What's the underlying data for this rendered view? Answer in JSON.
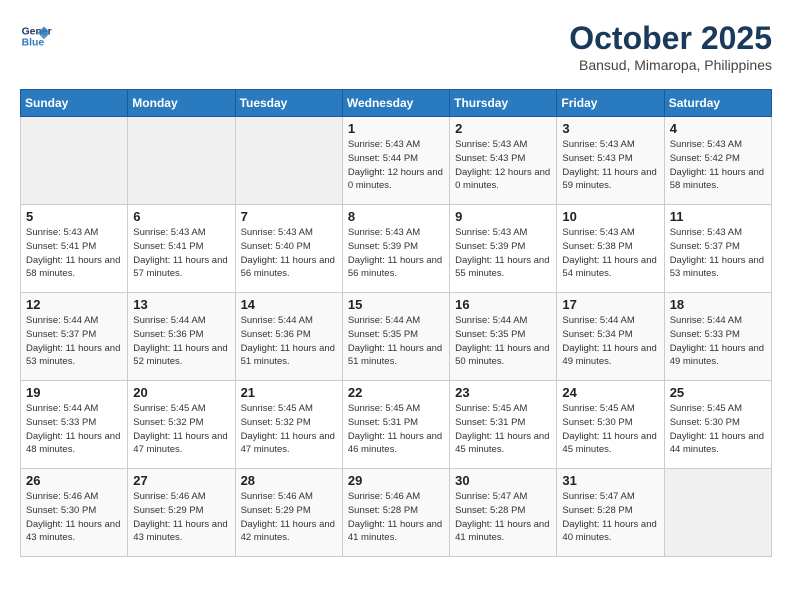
{
  "header": {
    "logo_line1": "General",
    "logo_line2": "Blue",
    "month": "October 2025",
    "location": "Bansud, Mimaropa, Philippines"
  },
  "weekdays": [
    "Sunday",
    "Monday",
    "Tuesday",
    "Wednesday",
    "Thursday",
    "Friday",
    "Saturday"
  ],
  "weeks": [
    [
      {
        "day": "",
        "empty": true
      },
      {
        "day": "",
        "empty": true
      },
      {
        "day": "",
        "empty": true
      },
      {
        "day": "1",
        "sunrise": "5:43 AM",
        "sunset": "5:44 PM",
        "daylight": "12 hours and 0 minutes."
      },
      {
        "day": "2",
        "sunrise": "5:43 AM",
        "sunset": "5:43 PM",
        "daylight": "12 hours and 0 minutes."
      },
      {
        "day": "3",
        "sunrise": "5:43 AM",
        "sunset": "5:43 PM",
        "daylight": "11 hours and 59 minutes."
      },
      {
        "day": "4",
        "sunrise": "5:43 AM",
        "sunset": "5:42 PM",
        "daylight": "11 hours and 58 minutes."
      }
    ],
    [
      {
        "day": "5",
        "sunrise": "5:43 AM",
        "sunset": "5:41 PM",
        "daylight": "11 hours and 58 minutes."
      },
      {
        "day": "6",
        "sunrise": "5:43 AM",
        "sunset": "5:41 PM",
        "daylight": "11 hours and 57 minutes."
      },
      {
        "day": "7",
        "sunrise": "5:43 AM",
        "sunset": "5:40 PM",
        "daylight": "11 hours and 56 minutes."
      },
      {
        "day": "8",
        "sunrise": "5:43 AM",
        "sunset": "5:39 PM",
        "daylight": "11 hours and 56 minutes."
      },
      {
        "day": "9",
        "sunrise": "5:43 AM",
        "sunset": "5:39 PM",
        "daylight": "11 hours and 55 minutes."
      },
      {
        "day": "10",
        "sunrise": "5:43 AM",
        "sunset": "5:38 PM",
        "daylight": "11 hours and 54 minutes."
      },
      {
        "day": "11",
        "sunrise": "5:43 AM",
        "sunset": "5:37 PM",
        "daylight": "11 hours and 53 minutes."
      }
    ],
    [
      {
        "day": "12",
        "sunrise": "5:44 AM",
        "sunset": "5:37 PM",
        "daylight": "11 hours and 53 minutes."
      },
      {
        "day": "13",
        "sunrise": "5:44 AM",
        "sunset": "5:36 PM",
        "daylight": "11 hours and 52 minutes."
      },
      {
        "day": "14",
        "sunrise": "5:44 AM",
        "sunset": "5:36 PM",
        "daylight": "11 hours and 51 minutes."
      },
      {
        "day": "15",
        "sunrise": "5:44 AM",
        "sunset": "5:35 PM",
        "daylight": "11 hours and 51 minutes."
      },
      {
        "day": "16",
        "sunrise": "5:44 AM",
        "sunset": "5:35 PM",
        "daylight": "11 hours and 50 minutes."
      },
      {
        "day": "17",
        "sunrise": "5:44 AM",
        "sunset": "5:34 PM",
        "daylight": "11 hours and 49 minutes."
      },
      {
        "day": "18",
        "sunrise": "5:44 AM",
        "sunset": "5:33 PM",
        "daylight": "11 hours and 49 minutes."
      }
    ],
    [
      {
        "day": "19",
        "sunrise": "5:44 AM",
        "sunset": "5:33 PM",
        "daylight": "11 hours and 48 minutes."
      },
      {
        "day": "20",
        "sunrise": "5:45 AM",
        "sunset": "5:32 PM",
        "daylight": "11 hours and 47 minutes."
      },
      {
        "day": "21",
        "sunrise": "5:45 AM",
        "sunset": "5:32 PM",
        "daylight": "11 hours and 47 minutes."
      },
      {
        "day": "22",
        "sunrise": "5:45 AM",
        "sunset": "5:31 PM",
        "daylight": "11 hours and 46 minutes."
      },
      {
        "day": "23",
        "sunrise": "5:45 AM",
        "sunset": "5:31 PM",
        "daylight": "11 hours and 45 minutes."
      },
      {
        "day": "24",
        "sunrise": "5:45 AM",
        "sunset": "5:30 PM",
        "daylight": "11 hours and 45 minutes."
      },
      {
        "day": "25",
        "sunrise": "5:45 AM",
        "sunset": "5:30 PM",
        "daylight": "11 hours and 44 minutes."
      }
    ],
    [
      {
        "day": "26",
        "sunrise": "5:46 AM",
        "sunset": "5:30 PM",
        "daylight": "11 hours and 43 minutes."
      },
      {
        "day": "27",
        "sunrise": "5:46 AM",
        "sunset": "5:29 PM",
        "daylight": "11 hours and 43 minutes."
      },
      {
        "day": "28",
        "sunrise": "5:46 AM",
        "sunset": "5:29 PM",
        "daylight": "11 hours and 42 minutes."
      },
      {
        "day": "29",
        "sunrise": "5:46 AM",
        "sunset": "5:28 PM",
        "daylight": "11 hours and 41 minutes."
      },
      {
        "day": "30",
        "sunrise": "5:47 AM",
        "sunset": "5:28 PM",
        "daylight": "11 hours and 41 minutes."
      },
      {
        "day": "31",
        "sunrise": "5:47 AM",
        "sunset": "5:28 PM",
        "daylight": "11 hours and 40 minutes."
      },
      {
        "day": "",
        "empty": true
      }
    ]
  ]
}
